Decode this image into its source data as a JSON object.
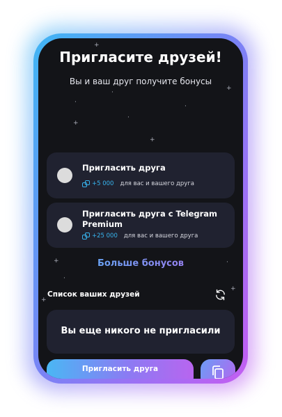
{
  "header": {
    "title": "Пригласите друзей!",
    "subtitle": "Вы и ваш друг получите бонусы"
  },
  "cards": [
    {
      "title": "Пригласить друга",
      "reward_amount": "+5 000",
      "reward_desc": "для вас и вашего друга",
      "icon": "coin-stack-icon"
    },
    {
      "title": "Пригласить друга с Telegram Premium",
      "reward_amount": "+25 000",
      "reward_desc": "для вас и вашего друга",
      "icon": "coin-stack-icon"
    }
  ],
  "more_bonuses_label": "Больше бонусов",
  "friends": {
    "label": "Список ваших друзей",
    "refresh_icon": "refresh-icon",
    "empty_text": "Вы еще никого не пригласили"
  },
  "footer": {
    "invite_button_label": "Пригласить друга",
    "copy_icon": "copy-icon"
  },
  "colors": {
    "background": "#131418",
    "card": "#202230",
    "accent_blue": "#37b4ee",
    "accent_purple": "#b865ef"
  }
}
